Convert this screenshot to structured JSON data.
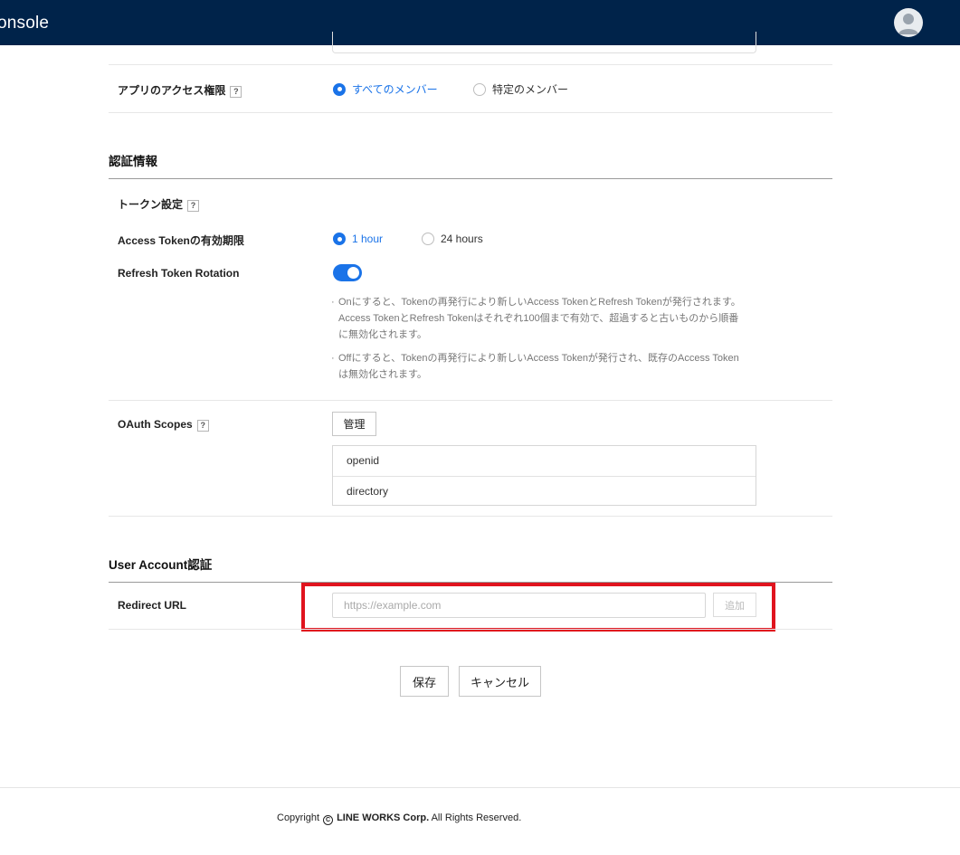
{
  "header": {
    "title": "onsole"
  },
  "access": {
    "label": "アプリのアクセス権限",
    "help": "?",
    "options": [
      "すべてのメンバー",
      "特定のメンバー"
    ],
    "selected": 0
  },
  "auth_section": {
    "title": "認証情報",
    "token_settings": {
      "label": "トークン設定",
      "help": "?"
    },
    "access_token": {
      "label": "Access Tokenの有効期限",
      "options": [
        "1 hour",
        "24 hours"
      ],
      "selected": 0
    },
    "refresh": {
      "label": "Refresh Token Rotation",
      "on": true,
      "note_on": "Onにすると、Tokenの再発行により新しいAccess TokenとRefresh Tokenが発行されます。Access TokenとRefresh Tokenはそれぞれ100個まで有効で、超過すると古いものから順番に無効化されます。",
      "note_off": "Offにすると、Tokenの再発行により新しいAccess Tokenが発行され、既存のAccess Tokenは無効化されます。"
    },
    "oauth": {
      "label": "OAuth Scopes",
      "help": "?",
      "manage_button": "管理",
      "scopes": [
        "openid",
        "directory"
      ]
    }
  },
  "user_section": {
    "title": "User Account認証",
    "redirect": {
      "label": "Redirect URL",
      "placeholder": "https://example.com",
      "add_button": "追加"
    }
  },
  "actions": {
    "save": "保存",
    "cancel": "キャンセル"
  },
  "footer": {
    "prefix": "Copyright",
    "symbol": "C",
    "company": "LINE WORKS Corp.",
    "suffix": "All Rights Reserved."
  },
  "colors": {
    "header_bg": "#00234a",
    "accent": "#1a73e8",
    "highlight": "#e0141e"
  }
}
